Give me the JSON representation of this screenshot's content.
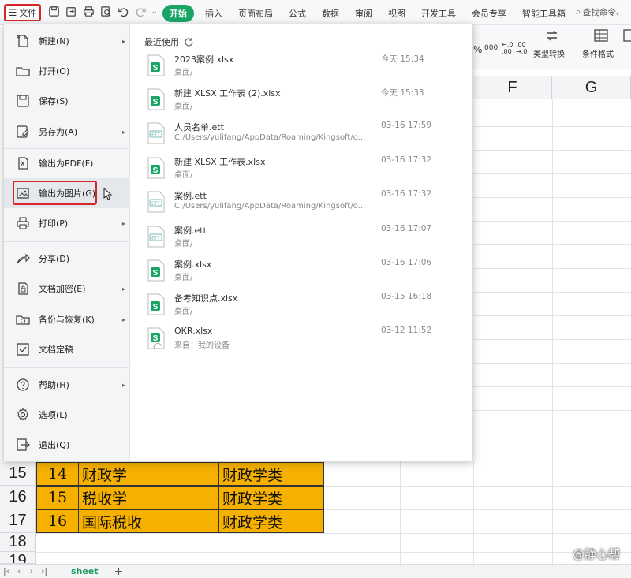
{
  "ribbon": {
    "file_label": "文件",
    "tabs": [
      "开始",
      "插入",
      "页面布局",
      "公式",
      "数据",
      "审阅",
      "视图",
      "开发工具",
      "会员专享",
      "智能工具箱"
    ],
    "search_placeholder": "查找命令、",
    "right_labels": {
      "type_convert": "类型转换",
      "cond_format": "条件格式"
    }
  },
  "file_menu": {
    "items": [
      {
        "label": "新建(N)",
        "icon": "new-icon",
        "submenu": true
      },
      {
        "label": "打开(O)",
        "icon": "folder-icon",
        "submenu": false
      },
      {
        "label": "保存(S)",
        "icon": "save-icon",
        "submenu": false
      },
      {
        "label": "另存为(A)",
        "icon": "save-as-icon",
        "submenu": true
      },
      {
        "label": "输出为PDF(F)",
        "icon": "pdf-icon",
        "submenu": false
      },
      {
        "label": "输出为图片(G)",
        "icon": "image-icon",
        "submenu": false,
        "highlighted": true
      },
      {
        "label": "打印(P)",
        "icon": "print-icon",
        "submenu": true
      },
      {
        "label": "分享(D)",
        "icon": "share-icon",
        "submenu": false
      },
      {
        "label": "文档加密(E)",
        "icon": "lock-icon",
        "submenu": true
      },
      {
        "label": "备份与恢复(K)",
        "icon": "backup-icon",
        "submenu": true
      },
      {
        "label": "文档定稿",
        "icon": "finalize-icon",
        "submenu": false
      },
      {
        "label": "帮助(H)",
        "icon": "help-icon",
        "submenu": true
      },
      {
        "label": "选项(L)",
        "icon": "gear-icon",
        "submenu": false
      },
      {
        "label": "退出(Q)",
        "icon": "exit-icon",
        "submenu": false
      }
    ],
    "recent_title": "最近使用",
    "recent_files": [
      {
        "name": "2023案例.xlsx",
        "path": "桌面/",
        "time": "今天  15:34",
        "type": "xlsx"
      },
      {
        "name": "新建 XLSX 工作表 (2).xlsx",
        "path": "桌面/",
        "time": "今天  15:33",
        "type": "xlsx"
      },
      {
        "name": "人员名单.ett",
        "path": "C:/Users/yulifang/AppData/Roaming/Kingsoft/o...",
        "time": "03-16 17:59",
        "type": "ett"
      },
      {
        "name": "新建 XLSX 工作表.xlsx",
        "path": "桌面/",
        "time": "03-16 17:32",
        "type": "xlsx"
      },
      {
        "name": "案例.ett",
        "path": "C:/Users/yulifang/AppData/Roaming/Kingsoft/o...",
        "time": "03-16 17:32",
        "type": "ett"
      },
      {
        "name": "案例.ett",
        "path": "桌面/",
        "time": "03-16 17:07",
        "type": "ett"
      },
      {
        "name": "案例.xlsx",
        "path": "桌面/",
        "time": "03-16 17:06",
        "type": "xlsx"
      },
      {
        "name": "备考知识点.xlsx",
        "path": "桌面/",
        "time": "03-15 16:18",
        "type": "xlsx"
      },
      {
        "name": "OKR.xlsx",
        "path": "来自：我的设备",
        "time": "03-12 11:52",
        "type": "xlsx-cloud"
      }
    ]
  },
  "sheet": {
    "col_headers": [
      "F",
      "G"
    ],
    "rows": [
      {
        "num": "15",
        "no": "14",
        "name": "财政学",
        "cat": "财政学类"
      },
      {
        "num": "16",
        "no": "15",
        "name": "税收学",
        "cat": "财政学类"
      },
      {
        "num": "17",
        "no": "16",
        "name": "国际税收",
        "cat": "财政学类"
      },
      {
        "num": "18"
      },
      {
        "num": "19"
      }
    ],
    "tab_name": "sheet",
    "add_label": "+"
  },
  "watermark": "@静心帮",
  "colors": {
    "accent": "#1aa567",
    "highlight_border": "#d62828",
    "cell_fill": "#f5b000"
  }
}
